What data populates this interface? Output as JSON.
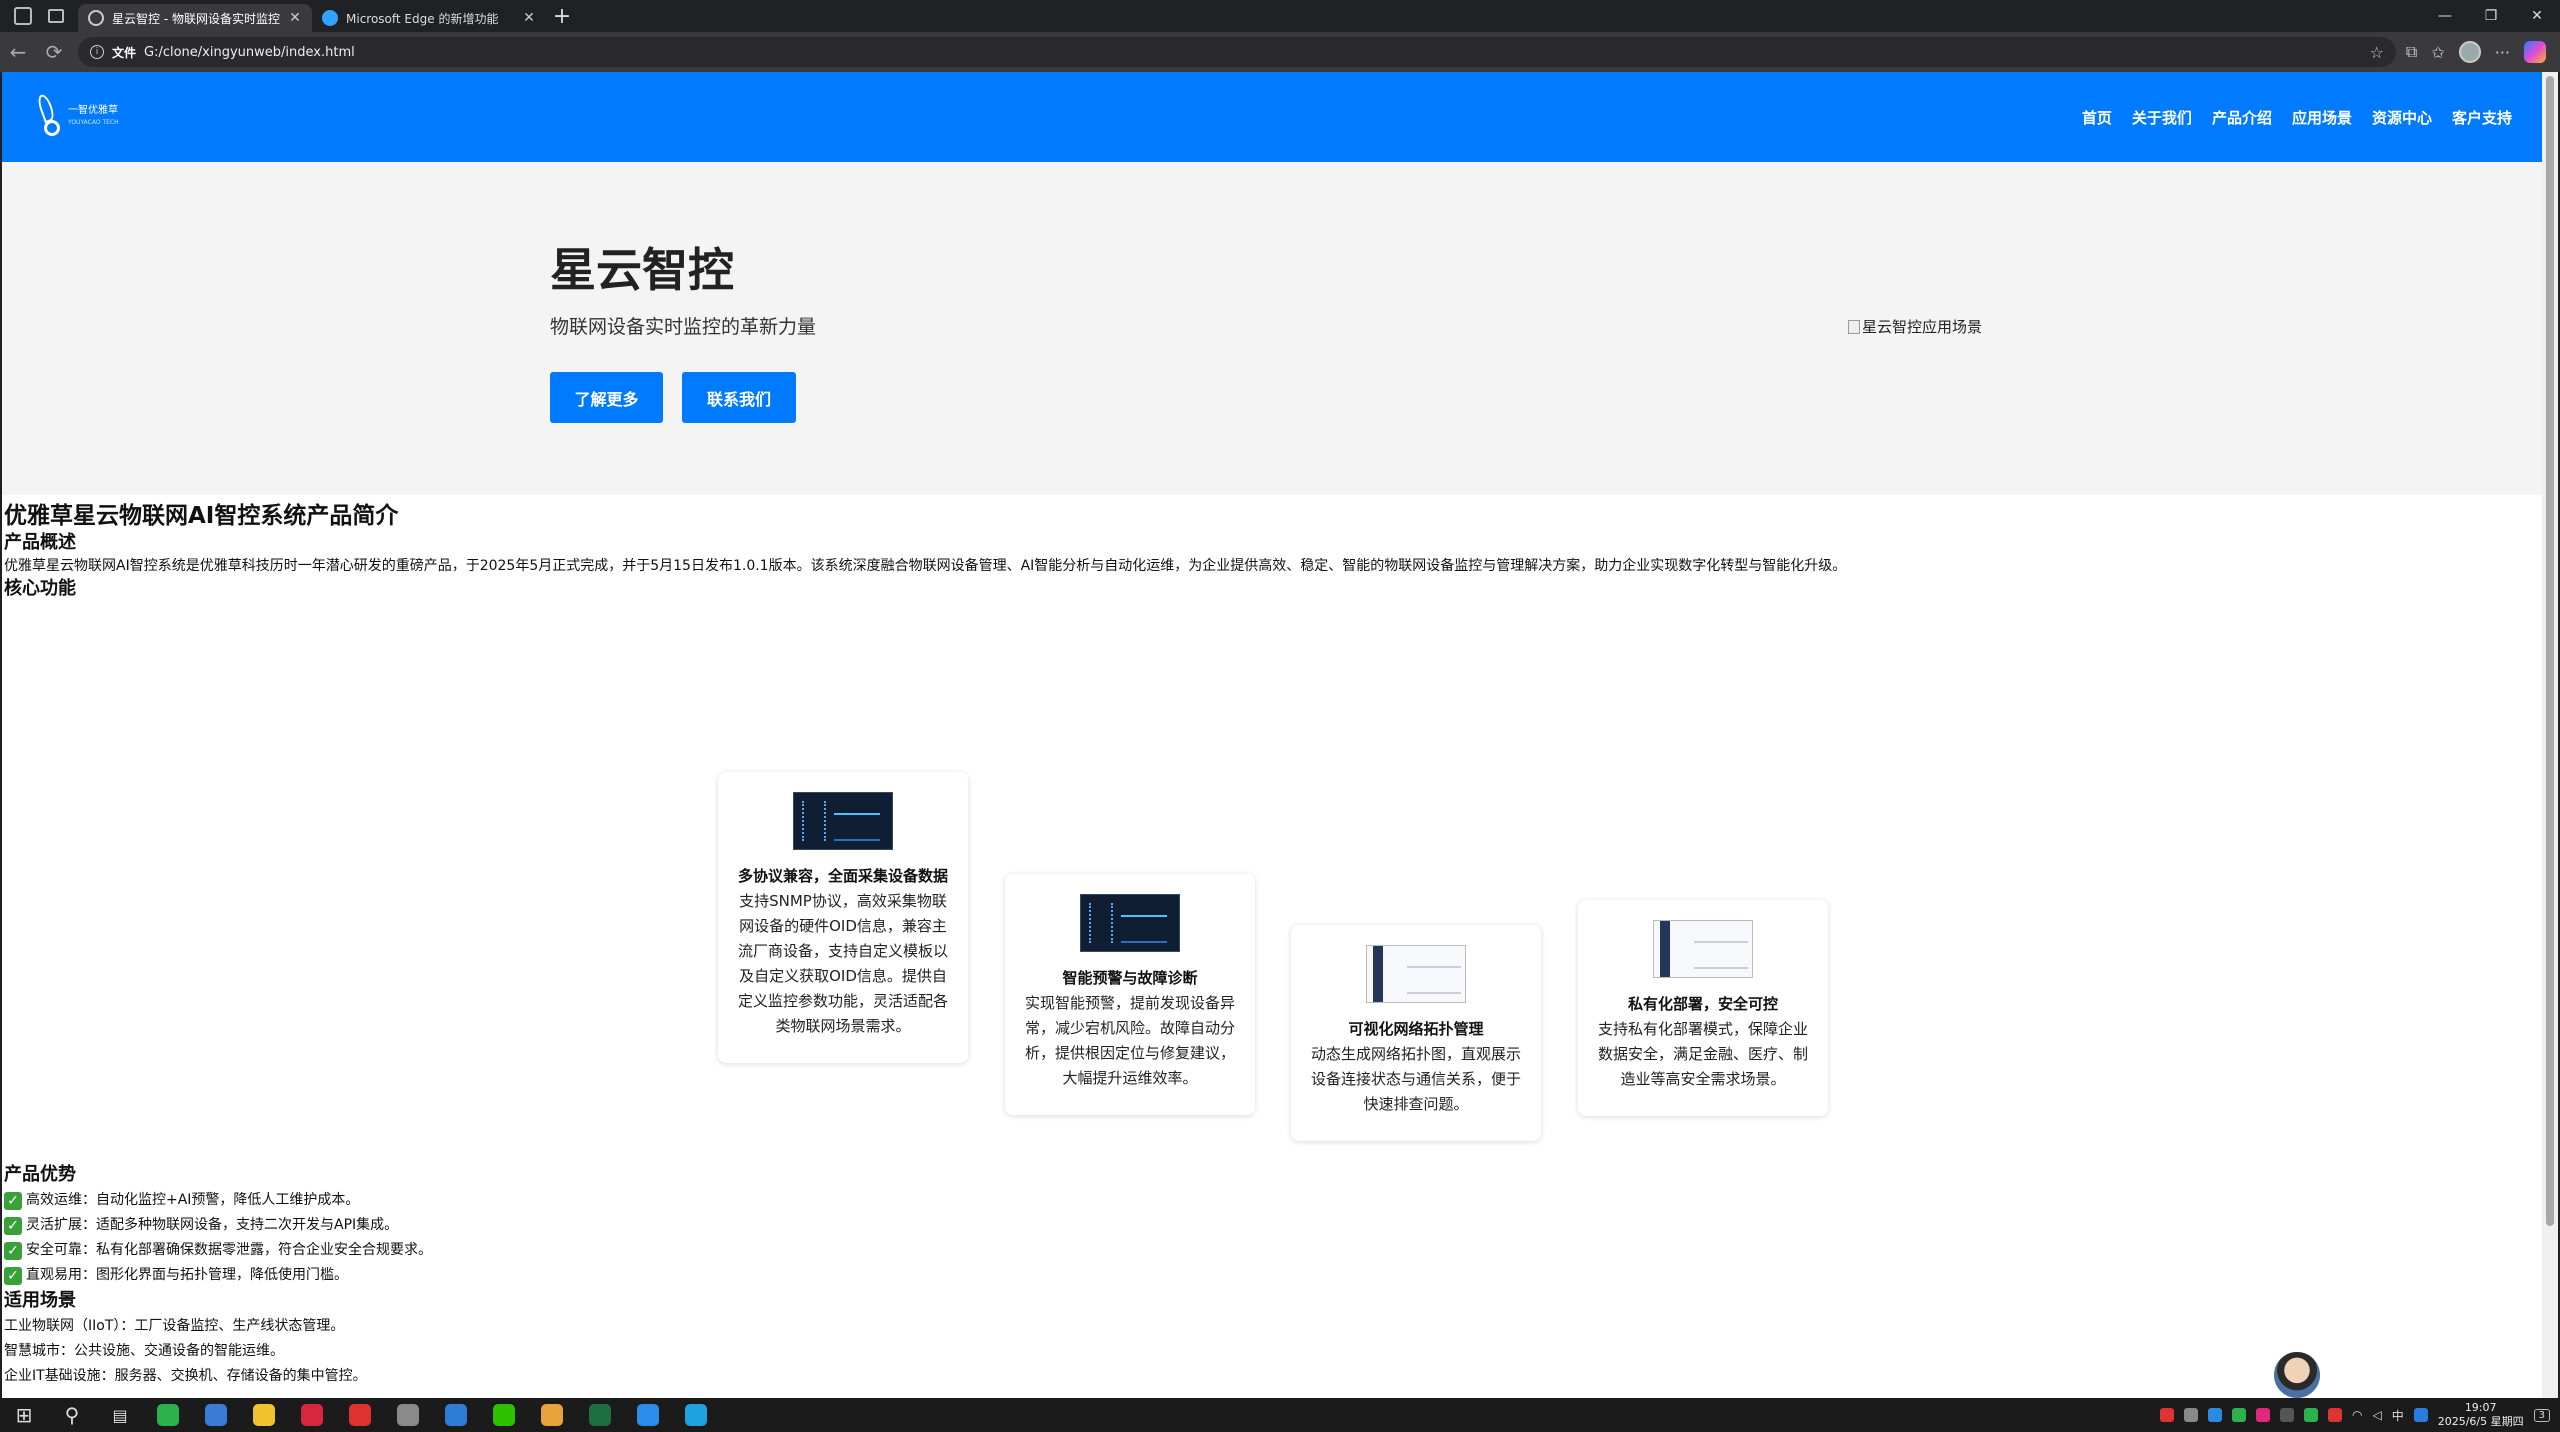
{
  "browser": {
    "tabs": [
      {
        "title": "星云智控 - 物联网设备实时监控与",
        "active": true,
        "icon_color": "#8ab4f8"
      },
      {
        "title": "Microsoft Edge 的新增功能",
        "active": false,
        "icon_color": "#2fa3ff"
      }
    ],
    "new_tab_symbol": "+",
    "window_controls": {
      "minimize": "—",
      "restore": "❐",
      "close": "✕"
    },
    "nav": {
      "back": "←",
      "reload": "⟳"
    },
    "address": {
      "info_icon": "i",
      "label": "文件",
      "url": "G:/clone/xingyunweb/index.html"
    },
    "toolbar_icons": [
      "star-icon",
      "extensions-icon",
      "favorites-icon",
      "profile-icon",
      "more-icon",
      "copilot-icon"
    ],
    "toolbar_symbols": {
      "star": "☆",
      "extensions": "⧉",
      "favorites": "✩",
      "more": "···"
    }
  },
  "site": {
    "logo": {
      "name": "一智优雅草",
      "sub": "YOUYACAO TECH"
    },
    "nav": [
      "首页",
      "关于我们",
      "产品介绍",
      "应用场景",
      "资源中心",
      "客户支持"
    ],
    "accent": "#007bff",
    "hero": {
      "title": "星云智控",
      "subtitle": "物联网设备实时监控的革新力量",
      "btn_more": "了解更多",
      "btn_contact": "联系我们",
      "img_alt": "星云智控应用场景"
    },
    "intro": {
      "title": "优雅草星云物联网AI智控系统产品简介",
      "overview_heading": "产品概述",
      "overview_text": "优雅草星云物联网AI智控系统是优雅草科技历时一年潜心研发的重磅产品，于2025年5月正式完成，并于5月15日发布1.0.1版本。该系统深度融合物联网设备管理、AI智能分析与自动化运维，为企业提供高效、稳定、智能的物联网设备监控与管理解决方案，助力企业实现数字化转型与智能化升级。",
      "features_heading": "核心功能"
    },
    "features": [
      {
        "title": "多协议兼容，全面采集设备数据",
        "desc": "支持SNMP协议，高效采集物联网设备的硬件OID信息，兼容主流厂商设备，支持自定义模板以及自定义获取OID信息。提供自定义监控参数功能，灵活适配各类物联网场景需求。"
      },
      {
        "title": "智能预警与故障诊断",
        "desc": "实现智能预警，提前发现设备异常，减少宕机风险。故障自动分析，提供根因定位与修复建议，大幅提升运维效率。"
      },
      {
        "title": "可视化网络拓扑管理",
        "desc": "动态生成网络拓扑图，直观展示设备连接状态与通信关系，便于快速排查问题。"
      },
      {
        "title": "私有化部署，安全可控",
        "desc": "支持私有化部署模式，保障企业数据安全，满足金融、医疗、制造业等高安全需求场景。"
      }
    ],
    "advantages": {
      "heading": "产品优势",
      "check_symbol": "✓",
      "items": [
        "高效运维：自动化监控+AI预警，降低人工维护成本。",
        "灵活扩展：适配多种物联网设备，支持二次开发与API集成。",
        "安全可靠：私有化部署确保数据零泄露，符合企业安全合规要求。",
        "直观易用：图形化界面与拓扑管理，降低使用门槛。"
      ]
    },
    "scenarios": {
      "heading": "适用场景",
      "items": [
        "工业物联网（IIoT）：工厂设备监控、生产线状态管理。",
        "智慧城市：公共设施、交通设备的智能运维。",
        "企业IT基础设施：服务器、交换机、存储设备的集中管控。"
      ]
    }
  },
  "taskbar": {
    "start_symbol": "⊞",
    "search_symbol": "⚲",
    "taskview_symbol": "▤",
    "apps": [
      "app-h",
      "app-browser",
      "app-files",
      "app-wps",
      "app-netease",
      "app-photo",
      "app-sogou",
      "app-wechat",
      "app-chrome",
      "app-excel",
      "app-vscode",
      "app-edge"
    ],
    "app_colors": [
      "#2bb24c",
      "#3a7bd5",
      "#f2c12e",
      "#d7263d",
      "#e03131",
      "#8a8a8a",
      "#2f7bd8",
      "#2dc100",
      "#e8a33d",
      "#1d6f42",
      "#2b8ceb",
      "#1fa3e0"
    ],
    "tray_lang": "中",
    "clock_time": "19:07",
    "clock_date": "2025/6/5 星期四",
    "notif_count": "3"
  }
}
